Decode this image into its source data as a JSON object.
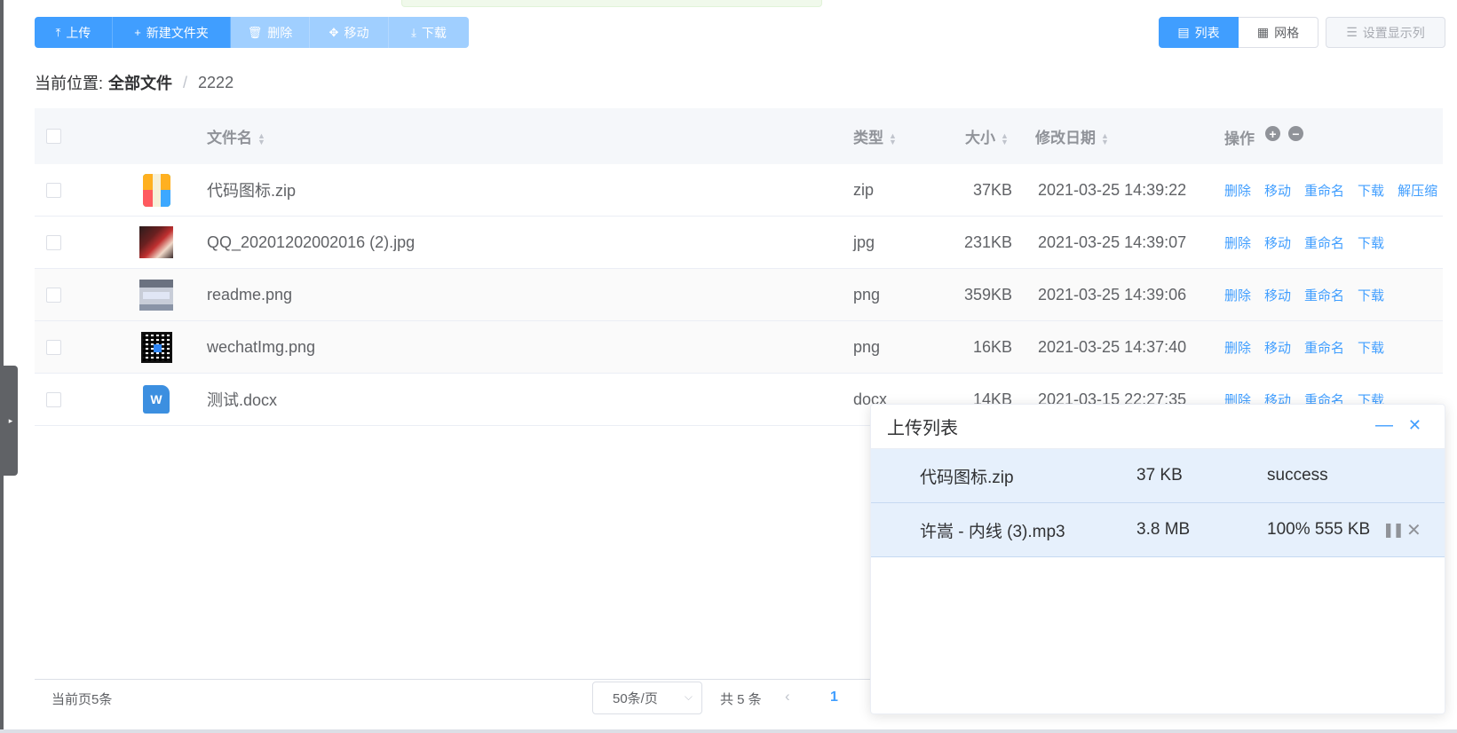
{
  "toolbar": {
    "upload": "上传",
    "new_folder": "新建文件夹",
    "delete": "删除",
    "move": "移动",
    "download": "下载"
  },
  "view": {
    "list": "列表",
    "grid": "网格",
    "set_columns": "设置显示列"
  },
  "breadcrumb": {
    "prefix": "当前位置:",
    "root": "全部文件",
    "separator": "/",
    "current": "2222"
  },
  "table": {
    "headers": {
      "name": "文件名",
      "type": "类型",
      "size": "大小",
      "date": "修改日期",
      "ops": "操作"
    },
    "rows": [
      {
        "icon": "zip-file-icon",
        "name": "代码图标.zip",
        "type": "zip",
        "size": "37KB",
        "date": "2021-03-25 14:39:22",
        "ops": [
          "删除",
          "移动",
          "重命名",
          "下载",
          "解压缩"
        ]
      },
      {
        "icon": "image-thumbnail",
        "name": "QQ_20201202002016 (2).jpg",
        "type": "jpg",
        "size": "231KB",
        "date": "2021-03-25 14:39:07",
        "ops": [
          "删除",
          "移动",
          "重命名",
          "下载"
        ]
      },
      {
        "icon": "image-thumbnail",
        "name": "readme.png",
        "type": "png",
        "size": "359KB",
        "date": "2021-03-25 14:39:06",
        "ops": [
          "删除",
          "移动",
          "重命名",
          "下载"
        ]
      },
      {
        "icon": "qr-code-thumbnail",
        "name": "wechatImg.png",
        "type": "png",
        "size": "16KB",
        "date": "2021-03-25 14:37:40",
        "ops": [
          "删除",
          "移动",
          "重命名",
          "下载"
        ]
      },
      {
        "icon": "word-doc-icon",
        "name": "测试.docx",
        "type": "docx",
        "size": "14KB",
        "date": "2021-03-15 22:27:35",
        "ops": [
          "删除",
          "移动",
          "重命名",
          "下载"
        ]
      }
    ]
  },
  "footer": {
    "current_count": "当前页5条",
    "page_size": "50条/页",
    "total": "共 5 条",
    "current_page": "1"
  },
  "upload_panel": {
    "title": "上传列表",
    "items": [
      {
        "name": "代码图标.zip",
        "size": "37 KB",
        "status": "success"
      },
      {
        "name": "许嵩 - 内线 (3).mp3",
        "size": "3.8 MB",
        "status": "100% 555 KB"
      }
    ]
  },
  "colors": {
    "primary": "#409eff",
    "primary_disabled": "#a0cfff",
    "upload_row_bg": "#e6f0fc"
  }
}
